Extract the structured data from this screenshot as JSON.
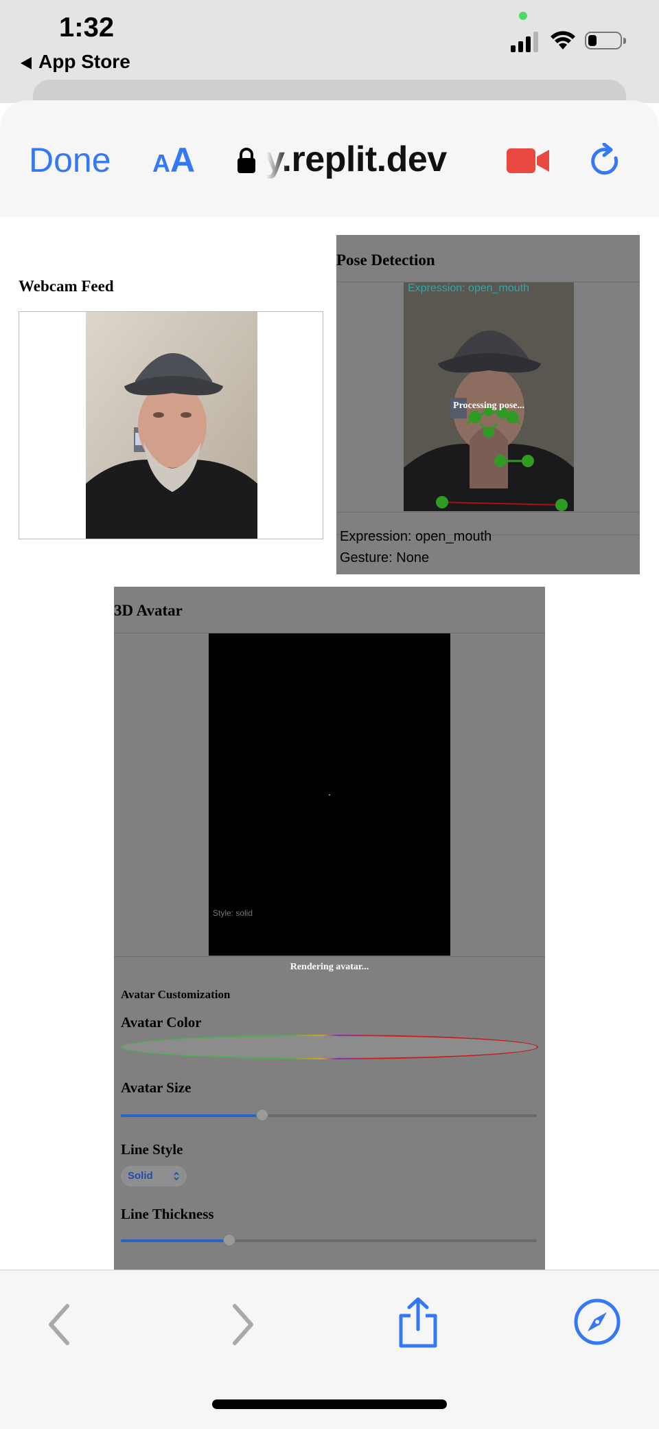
{
  "status_bar": {
    "time": "1:32",
    "back_label": "App Store"
  },
  "browser": {
    "done_label": "Done",
    "aa_small": "A",
    "aa_big": "A",
    "url": "y.replit.dev"
  },
  "webcam": {
    "title": "Webcam Feed"
  },
  "pose": {
    "title": "Pose Detection",
    "overlay_expression": "Expression: open_mouth",
    "processing": "Processing pose...",
    "expression": "Expression: open_mouth",
    "gesture": "Gesture: None"
  },
  "avatar": {
    "title": "3D Avatar",
    "style_label": "Style: solid",
    "rendering": "Rendering avatar...",
    "customization_title": "Avatar Customization",
    "color_label": "Avatar Color",
    "size_label": "Avatar Size",
    "size_value": 0.34,
    "line_style_label": "Line Style",
    "line_style_value": "Solid",
    "thickness_label": "Line Thickness",
    "thickness_value": 0.26
  },
  "colors": {
    "accent": "#3478f6",
    "record": "#e8483f",
    "panel_gray": "#808080"
  }
}
